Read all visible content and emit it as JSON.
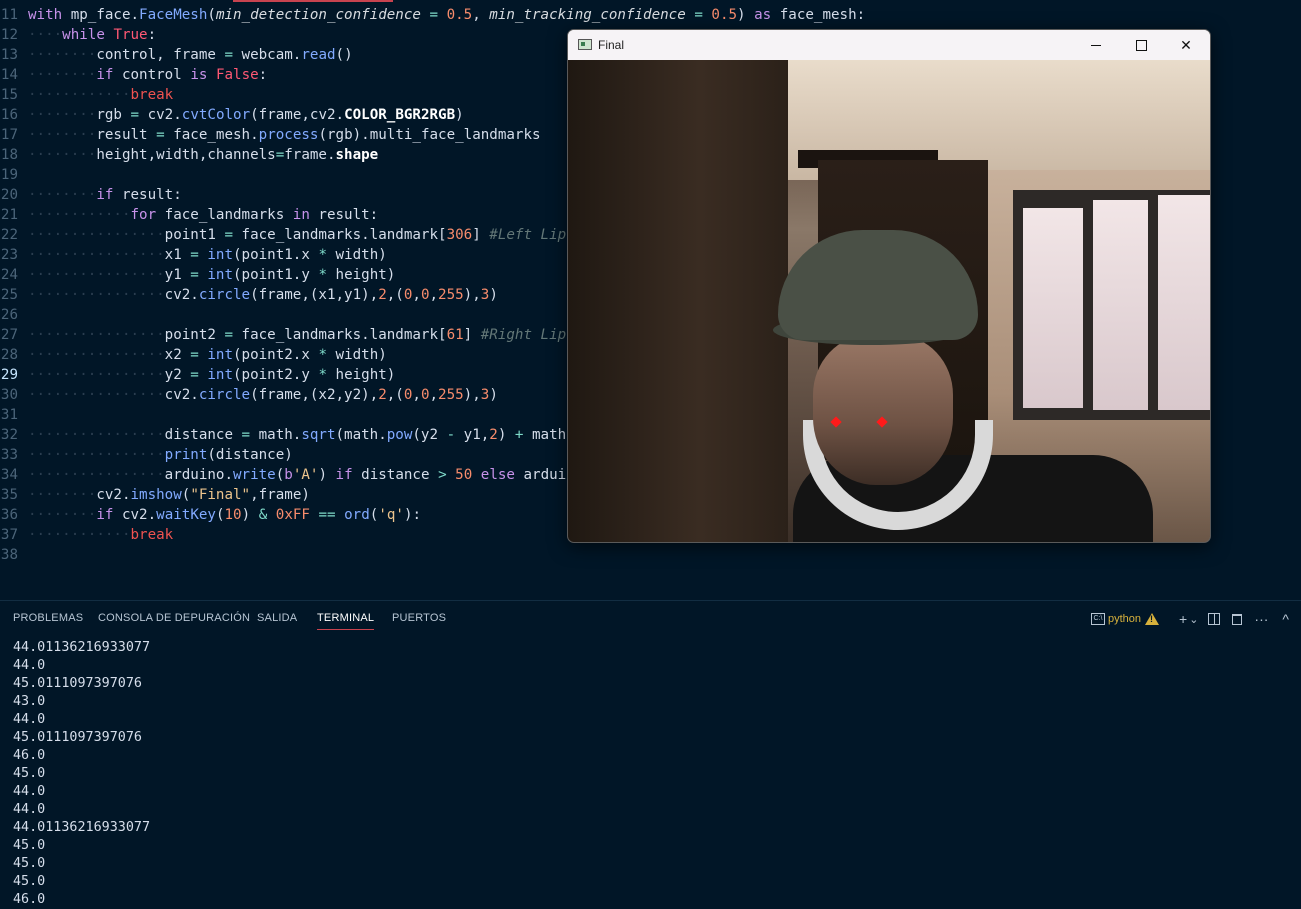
{
  "editor": {
    "lines": [
      {
        "n": "11",
        "parts": [
          [
            "kw",
            "with"
          ],
          [
            "var",
            " mp_face."
          ],
          [
            "fn",
            "FaceMesh"
          ],
          [
            "var",
            "("
          ],
          [
            "param",
            "min_detection_confidence"
          ],
          [
            "var",
            " "
          ],
          [
            "op",
            "="
          ],
          [
            "var",
            " "
          ],
          [
            "num",
            "0.5"
          ],
          [
            "var",
            ", "
          ],
          [
            "param",
            "min_tracking_confidence"
          ],
          [
            "var",
            " "
          ],
          [
            "op",
            "="
          ],
          [
            "var",
            " "
          ],
          [
            "num",
            "0.5"
          ],
          [
            "var",
            ") "
          ],
          [
            "kw",
            "as"
          ],
          [
            "var",
            " face_mesh:"
          ]
        ]
      },
      {
        "n": "12",
        "parts": [
          [
            "ws",
            "····"
          ],
          [
            "ctl",
            "while"
          ],
          [
            "var",
            " "
          ],
          [
            "bool",
            "True"
          ],
          [
            "var",
            ":"
          ]
        ]
      },
      {
        "n": "13",
        "parts": [
          [
            "ws",
            "········"
          ],
          [
            "var",
            "control, frame "
          ],
          [
            "op",
            "="
          ],
          [
            "var",
            " webcam."
          ],
          [
            "fn",
            "read"
          ],
          [
            "var",
            "()"
          ]
        ]
      },
      {
        "n": "14",
        "parts": [
          [
            "ws",
            "········"
          ],
          [
            "ctl",
            "if"
          ],
          [
            "var",
            " control "
          ],
          [
            "kw",
            "is"
          ],
          [
            "var",
            " "
          ],
          [
            "bool",
            "False"
          ],
          [
            "var",
            ":"
          ]
        ]
      },
      {
        "n": "15",
        "parts": [
          [
            "ws",
            "············"
          ],
          [
            "brk",
            "break"
          ]
        ]
      },
      {
        "n": "16",
        "parts": [
          [
            "ws",
            "········"
          ],
          [
            "var",
            "rgb "
          ],
          [
            "op",
            "="
          ],
          [
            "var",
            " cv2."
          ],
          [
            "fn",
            "cvtColor"
          ],
          [
            "var",
            "(frame,cv2."
          ],
          [
            "bold",
            "COLOR_BGR2RGB"
          ],
          [
            "var",
            ")"
          ]
        ]
      },
      {
        "n": "17",
        "parts": [
          [
            "ws",
            "········"
          ],
          [
            "var",
            "result "
          ],
          [
            "op",
            "="
          ],
          [
            "var",
            " face_mesh."
          ],
          [
            "fn",
            "process"
          ],
          [
            "var",
            "(rgb).multi_face_landmarks"
          ]
        ]
      },
      {
        "n": "18",
        "parts": [
          [
            "ws",
            "········"
          ],
          [
            "var",
            "height,width,channels"
          ],
          [
            "op",
            "="
          ],
          [
            "var",
            "frame."
          ],
          [
            "bold",
            "shape"
          ]
        ]
      },
      {
        "n": "19",
        "parts": []
      },
      {
        "n": "20",
        "parts": [
          [
            "ws",
            "········"
          ],
          [
            "ctl",
            "if"
          ],
          [
            "var",
            " result:"
          ]
        ]
      },
      {
        "n": "21",
        "parts": [
          [
            "ws",
            "············"
          ],
          [
            "ctl",
            "for"
          ],
          [
            "var",
            " face_landmarks "
          ],
          [
            "kw",
            "in"
          ],
          [
            "var",
            " result:"
          ]
        ]
      },
      {
        "n": "22",
        "parts": [
          [
            "ws",
            "················"
          ],
          [
            "var",
            "point1 "
          ],
          [
            "op",
            "="
          ],
          [
            "var",
            " face_landmarks.landmark["
          ],
          [
            "num",
            "306"
          ],
          [
            "var",
            "] "
          ],
          [
            "cmt",
            "#Left Lip co"
          ]
        ]
      },
      {
        "n": "23",
        "parts": [
          [
            "ws",
            "················"
          ],
          [
            "var",
            "x1 "
          ],
          [
            "op",
            "="
          ],
          [
            "var",
            " "
          ],
          [
            "fn",
            "int"
          ],
          [
            "var",
            "(point1.x "
          ],
          [
            "op",
            "*"
          ],
          [
            "var",
            " width)"
          ]
        ]
      },
      {
        "n": "24",
        "parts": [
          [
            "ws",
            "················"
          ],
          [
            "var",
            "y1 "
          ],
          [
            "op",
            "="
          ],
          [
            "var",
            " "
          ],
          [
            "fn",
            "int"
          ],
          [
            "var",
            "(point1.y "
          ],
          [
            "op",
            "*"
          ],
          [
            "var",
            " height)"
          ]
        ]
      },
      {
        "n": "25",
        "parts": [
          [
            "ws",
            "················"
          ],
          [
            "var",
            "cv2."
          ],
          [
            "fn",
            "circle"
          ],
          [
            "var",
            "(frame,(x1,y1),"
          ],
          [
            "num",
            "2"
          ],
          [
            "var",
            ",("
          ],
          [
            "num",
            "0"
          ],
          [
            "var",
            ","
          ],
          [
            "num",
            "0"
          ],
          [
            "var",
            ","
          ],
          [
            "num",
            "255"
          ],
          [
            "var",
            "),"
          ],
          [
            "num",
            "3"
          ],
          [
            "var",
            ")"
          ]
        ]
      },
      {
        "n": "26",
        "parts": []
      },
      {
        "n": "27",
        "parts": [
          [
            "ws",
            "················"
          ],
          [
            "var",
            "point2 "
          ],
          [
            "op",
            "="
          ],
          [
            "var",
            " face_landmarks.landmark["
          ],
          [
            "num",
            "61"
          ],
          [
            "var",
            "] "
          ],
          [
            "cmt",
            "#Right Lip co"
          ]
        ]
      },
      {
        "n": "28",
        "parts": [
          [
            "ws",
            "················"
          ],
          [
            "var",
            "x2 "
          ],
          [
            "op",
            "="
          ],
          [
            "var",
            " "
          ],
          [
            "fn",
            "int"
          ],
          [
            "var",
            "(point2.x "
          ],
          [
            "op",
            "*"
          ],
          [
            "var",
            " width)"
          ]
        ]
      },
      {
        "n": "29",
        "active": true,
        "parts": [
          [
            "ws",
            "················"
          ],
          [
            "var",
            "y2 "
          ],
          [
            "op",
            "="
          ],
          [
            "var",
            " "
          ],
          [
            "fn",
            "int"
          ],
          [
            "var",
            "(point2.y "
          ],
          [
            "op",
            "*"
          ],
          [
            "var",
            " height)"
          ]
        ]
      },
      {
        "n": "30",
        "parts": [
          [
            "ws",
            "················"
          ],
          [
            "var",
            "cv2."
          ],
          [
            "fn",
            "circle"
          ],
          [
            "var",
            "(frame,(x2,y2),"
          ],
          [
            "num",
            "2"
          ],
          [
            "var",
            ",("
          ],
          [
            "num",
            "0"
          ],
          [
            "var",
            ","
          ],
          [
            "num",
            "0"
          ],
          [
            "var",
            ","
          ],
          [
            "num",
            "255"
          ],
          [
            "var",
            "),"
          ],
          [
            "num",
            "3"
          ],
          [
            "var",
            ")"
          ]
        ]
      },
      {
        "n": "31",
        "parts": []
      },
      {
        "n": "32",
        "parts": [
          [
            "ws",
            "················"
          ],
          [
            "var",
            "distance "
          ],
          [
            "op",
            "="
          ],
          [
            "var",
            " math."
          ],
          [
            "fn",
            "sqrt"
          ],
          [
            "var",
            "(math."
          ],
          [
            "fn",
            "pow"
          ],
          [
            "var",
            "(y2 "
          ],
          [
            "op",
            "-"
          ],
          [
            "var",
            " y1,"
          ],
          [
            "num",
            "2"
          ],
          [
            "var",
            ") "
          ],
          [
            "op",
            "+"
          ],
          [
            "var",
            " math.po"
          ]
        ]
      },
      {
        "n": "33",
        "parts": [
          [
            "ws",
            "················"
          ],
          [
            "fn",
            "print"
          ],
          [
            "var",
            "(distance)"
          ]
        ]
      },
      {
        "n": "34",
        "parts": [
          [
            "ws",
            "················"
          ],
          [
            "var",
            "arduino."
          ],
          [
            "fn",
            "write"
          ],
          [
            "var",
            "("
          ],
          [
            "kw",
            "b"
          ],
          [
            "str",
            "'A'"
          ],
          [
            "var",
            ") "
          ],
          [
            "ctl",
            "if"
          ],
          [
            "var",
            " distance "
          ],
          [
            "op",
            ">"
          ],
          [
            "var",
            " "
          ],
          [
            "num",
            "50"
          ],
          [
            "var",
            " "
          ],
          [
            "ctl",
            "else"
          ],
          [
            "var",
            " arduino."
          ]
        ]
      },
      {
        "n": "35",
        "parts": [
          [
            "ws",
            "········"
          ],
          [
            "var",
            "cv2."
          ],
          [
            "fn",
            "imshow"
          ],
          [
            "var",
            "("
          ],
          [
            "str",
            "\"Final\""
          ],
          [
            "var",
            ",frame)"
          ]
        ]
      },
      {
        "n": "36",
        "parts": [
          [
            "ws",
            "········"
          ],
          [
            "ctl",
            "if"
          ],
          [
            "var",
            " cv2."
          ],
          [
            "fn",
            "waitKey"
          ],
          [
            "var",
            "("
          ],
          [
            "num",
            "10"
          ],
          [
            "var",
            ") "
          ],
          [
            "op",
            "&"
          ],
          [
            "var",
            " "
          ],
          [
            "num",
            "0xFF"
          ],
          [
            "var",
            " "
          ],
          [
            "op",
            "=="
          ],
          [
            "var",
            " "
          ],
          [
            "fn",
            "ord"
          ],
          [
            "var",
            "("
          ],
          [
            "str",
            "'q'"
          ],
          [
            "var",
            "):"
          ]
        ]
      },
      {
        "n": "37",
        "parts": [
          [
            "ws",
            "············"
          ],
          [
            "brk",
            "break"
          ]
        ]
      },
      {
        "n": "38",
        "parts": []
      }
    ]
  },
  "window": {
    "title": "Final",
    "minimize_label": "—",
    "maximize_label": "",
    "close_label": "✕"
  },
  "panel": {
    "tabs": [
      "PROBLEMAS",
      "CONSOLA DE DEPURACIÓN",
      "SALIDA",
      "TERMINAL",
      "PUERTOS"
    ],
    "active_tab": "TERMINAL",
    "terminal_name": "python",
    "add_label": "+",
    "dropdown_label": "⌄",
    "more_label": "···",
    "maximize_label": "^",
    "output": [
      "44.01136216933077",
      "44.0",
      "45.0111097397076",
      "43.0",
      "44.0",
      "45.0111097397076",
      "46.0",
      "45.0",
      "44.0",
      "44.0",
      "44.01136216933077",
      "45.0",
      "45.0",
      "45.0",
      "46.0"
    ]
  },
  "icons": {
    "app": "window-app-icon",
    "warning_color": "#d7b13c",
    "accent": "#c7434f",
    "landmark_color": "#ff1a1a"
  }
}
